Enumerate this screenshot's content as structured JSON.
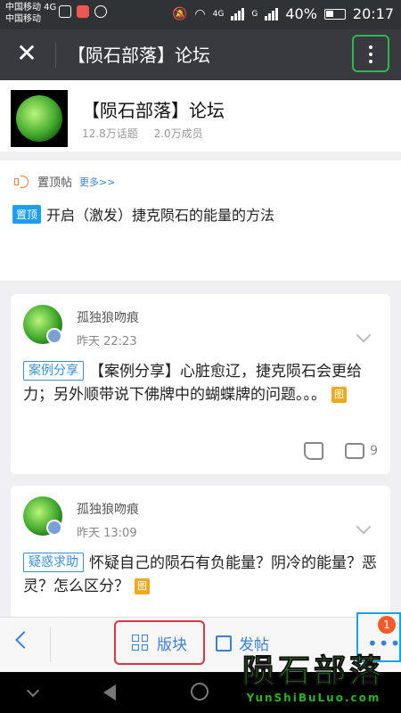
{
  "status": {
    "carrier1": "中国移动 4G",
    "carrier2": "中国移动",
    "network": "4G",
    "signal2": "G",
    "battery": "40%",
    "time": "20:17"
  },
  "appbar": {
    "title": "【陨石部落】论坛"
  },
  "forum": {
    "name": "【陨石部落】论坛",
    "topics": "12.8万话题",
    "members": "2.0万成员"
  },
  "pinned": {
    "label": "置顶帖",
    "more": "更多>>",
    "tag": "置顶",
    "title": "开启（激发）捷克陨石的能量的方法"
  },
  "posts": [
    {
      "user": "孤独狼吻痕",
      "time": "昨天 22:23",
      "tag": "案例分享",
      "text": "【案例分享】心脏愈辽，捷克陨石会更给力；另外顺带说下佛牌中的蝴蝶牌的问题。。。",
      "img_label": "图",
      "comments": "9"
    },
    {
      "user": "孤独狼吻痕",
      "time": "昨天 13:09",
      "tag": "疑惑求助",
      "text": "怀疑自己的陨石有负能量？阴冷的能量？恶灵？怎么区分？",
      "img_label": "图"
    }
  ],
  "bottombar": {
    "section": "版块",
    "post": "发帖",
    "notif_count": "1"
  },
  "watermark": {
    "cn": "陨石部落",
    "en": "YunShiBuLuo.com"
  }
}
